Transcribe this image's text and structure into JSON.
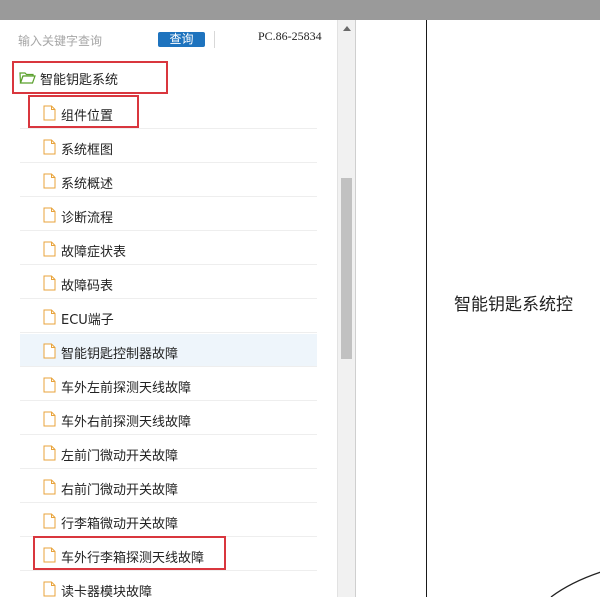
{
  "search": {
    "placeholder": "输入关键字查询",
    "button_label": "查询",
    "pc_code": "PC.86-25834"
  },
  "tree": {
    "root_label": "智能钥匙系统",
    "items": [
      {
        "label": "组件位置"
      },
      {
        "label": "系统框图"
      },
      {
        "label": "系统概述"
      },
      {
        "label": "诊断流程"
      },
      {
        "label": "故障症状表"
      },
      {
        "label": "故障码表"
      },
      {
        "label": "ECU端子"
      },
      {
        "label": "智能钥匙控制器故障"
      },
      {
        "label": "车外左前探测天线故障"
      },
      {
        "label": "车外右前探测天线故障"
      },
      {
        "label": "左前门微动开关故障"
      },
      {
        "label": "右前门微动开关故障"
      },
      {
        "label": "行李箱微动开关故障"
      },
      {
        "label": "车外行李箱探测天线故障"
      },
      {
        "label": "读卡器模块故障"
      }
    ],
    "selected_index": 7
  },
  "content": {
    "diagram_title": "智能钥匙系统控"
  },
  "colors": {
    "highlight": "#d9363e",
    "search_button": "#1e73be",
    "selected_row": "#eef5fb",
    "folder": "#5aa02c",
    "doc": "#e8a33b"
  }
}
